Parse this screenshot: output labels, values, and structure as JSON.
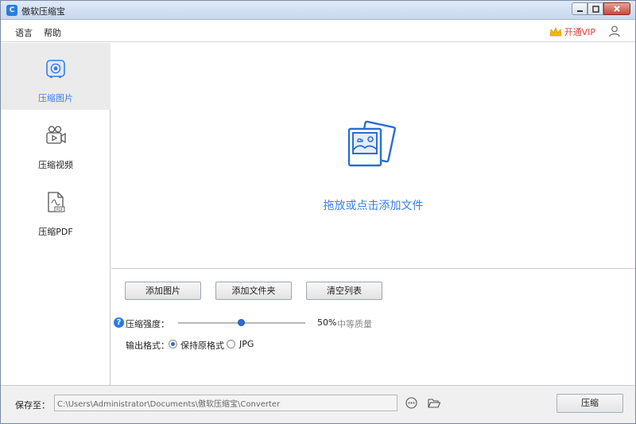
{
  "window": {
    "title": "傲软压缩宝"
  },
  "menubar": {
    "language": "语言",
    "help": "帮助",
    "vip_label": "开通VIP"
  },
  "sidebar": {
    "items": [
      {
        "label": "压缩图片",
        "icon": "camera-icon",
        "active": true
      },
      {
        "label": "压缩视频",
        "icon": "video-camera-icon",
        "active": false
      },
      {
        "label": "压缩PDF",
        "icon": "pdf-icon",
        "active": false
      }
    ]
  },
  "dropzone": {
    "text": "拖放或点击添加文件"
  },
  "controls": {
    "add_image": "添加图片",
    "add_folder": "添加文件夹",
    "clear_list": "清空列表",
    "strength_label": "压缩强度：",
    "strength_value": "50%",
    "strength_level": 0.5,
    "quality_label": "中等质量",
    "format_label": "输出格式：",
    "format_original": "保持原格式",
    "format_jpg": "JPG",
    "selected_format": "保持原格式"
  },
  "bottombar": {
    "save_label": "保存至：",
    "save_path": "C:\\Users\\Administrator\\Documents\\傲软压缩宝\\Converter",
    "compress_button": "压缩"
  },
  "colors": {
    "accent": "#3d7de4",
    "vip": "#e53935"
  }
}
